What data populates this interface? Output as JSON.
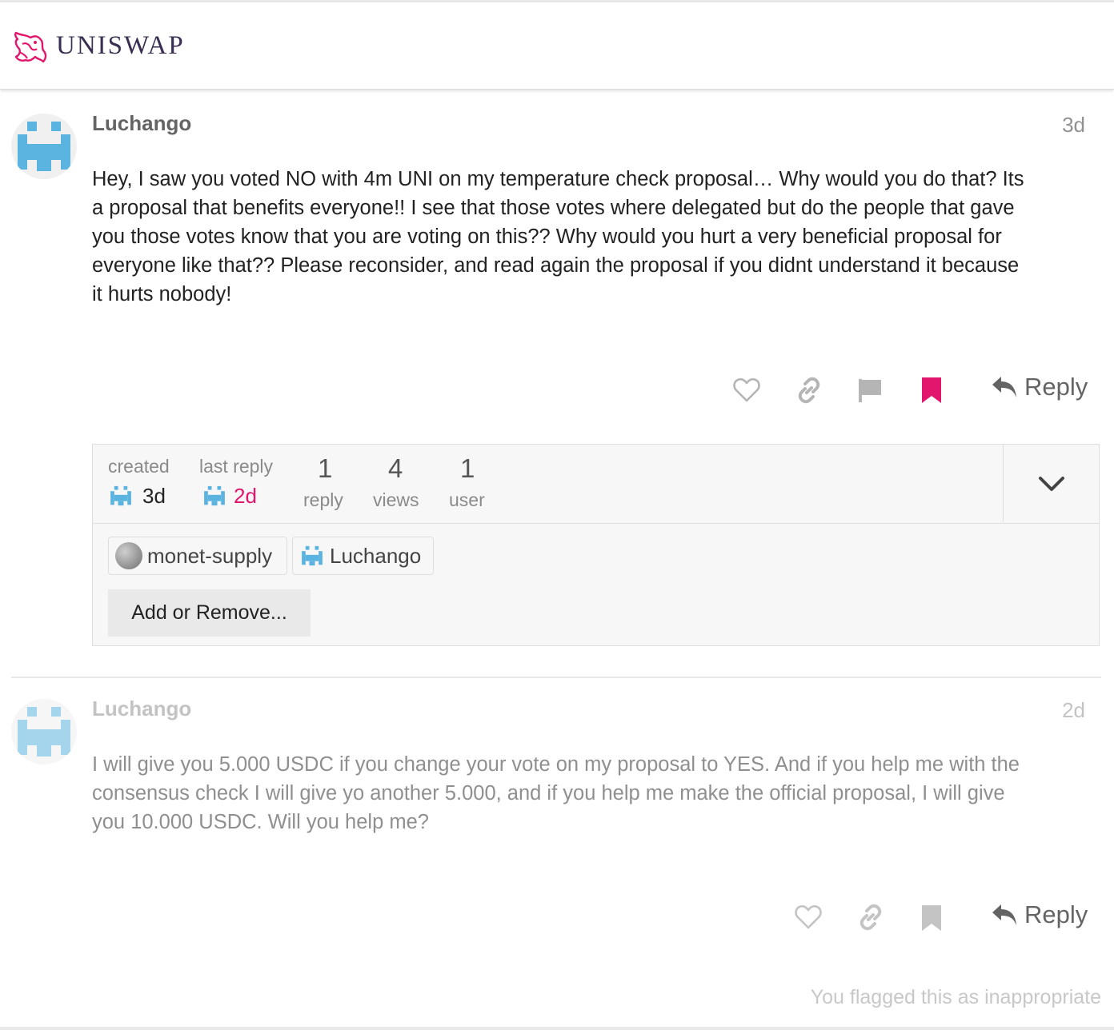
{
  "header": {
    "logo_text": "UNISWAP",
    "logo_icon": "unicorn-icon"
  },
  "colors": {
    "accent": "#e3166e",
    "avatar_blue": "#5bb3e0",
    "brand_text": "#3a2f52"
  },
  "post1": {
    "username": "Luchango",
    "date": "3d",
    "lines": [
      "Hey, I saw you voted NO with 4m UNI on my temperature check proposal… Why would you do that? Its",
      "a proposal that benefits everyone!! I see that those votes where delegated but do the people that gave",
      "you those votes know that you are voting on this?? Why would you hurt a very beneficial proposal for",
      "everyone like that?? Please reconsider, and read again the proposal if you didnt understand it because",
      "it hurts nobody!"
    ],
    "reply_label": "Reply"
  },
  "topic_map": {
    "created_label": "created",
    "created_value": "3d",
    "last_reply_label": "last reply",
    "last_reply_value": "2d",
    "replies_count": "1",
    "replies_label": "reply",
    "views_count": "4",
    "views_label": "views",
    "users_count": "1",
    "users_label": "user",
    "participants": [
      "monet-supply",
      "Luchango"
    ],
    "add_remove_label": "Add or Remove..."
  },
  "post2": {
    "username": "Luchango",
    "date": "2d",
    "lines": [
      "I will give you 5.000 USDC if you change your vote on my proposal to YES. And if you help me with the",
      "consensus check I will give yo another 5.000, and if you help me make the official proposal, I will give",
      "you 10.000 USDC. Will you help me?"
    ],
    "reply_label": "Reply",
    "flag_notice": "You flagged this as inappropriate"
  }
}
